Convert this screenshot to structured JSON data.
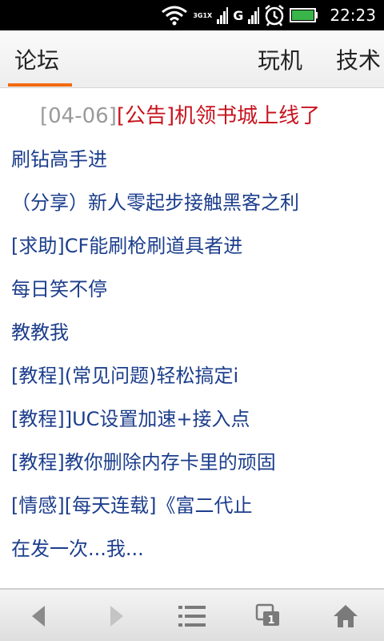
{
  "status_bar": {
    "time": "22:23",
    "net_top": "3G",
    "net_bottom": "1X",
    "net_g": "G",
    "icons": [
      "wifi-icon",
      "signal-icon",
      "alarm-icon",
      "battery-icon"
    ],
    "battery_color": "#39b54a"
  },
  "tabs": [
    {
      "label": "论坛",
      "selected": true
    },
    {
      "label": "玩机",
      "selected": false
    },
    {
      "label": "技术",
      "selected": false
    }
  ],
  "accent_color": "#f26a10",
  "notice": {
    "date": "[04-06]",
    "title": "[公告]机领书城上线了"
  },
  "posts": [
    "刷钻高手进",
    "（分享）新人零起步接触黑客之利",
    "[求助]CF能刷枪刷道具者进",
    "每日笑不停",
    "教教我",
    "[教程](常见问题)轻松搞定i",
    "[教程]]UC设置加速+接入点",
    "[教程]教你删除内存卡里的顽固",
    "[情感][每天连载]《富二代止",
    "在发一次...我..."
  ],
  "toolbar": {
    "windows_count": "1",
    "icons": [
      "back-arrow-icon",
      "forward-arrow-icon",
      "menu-list-icon",
      "windows-icon",
      "home-icon"
    ]
  }
}
